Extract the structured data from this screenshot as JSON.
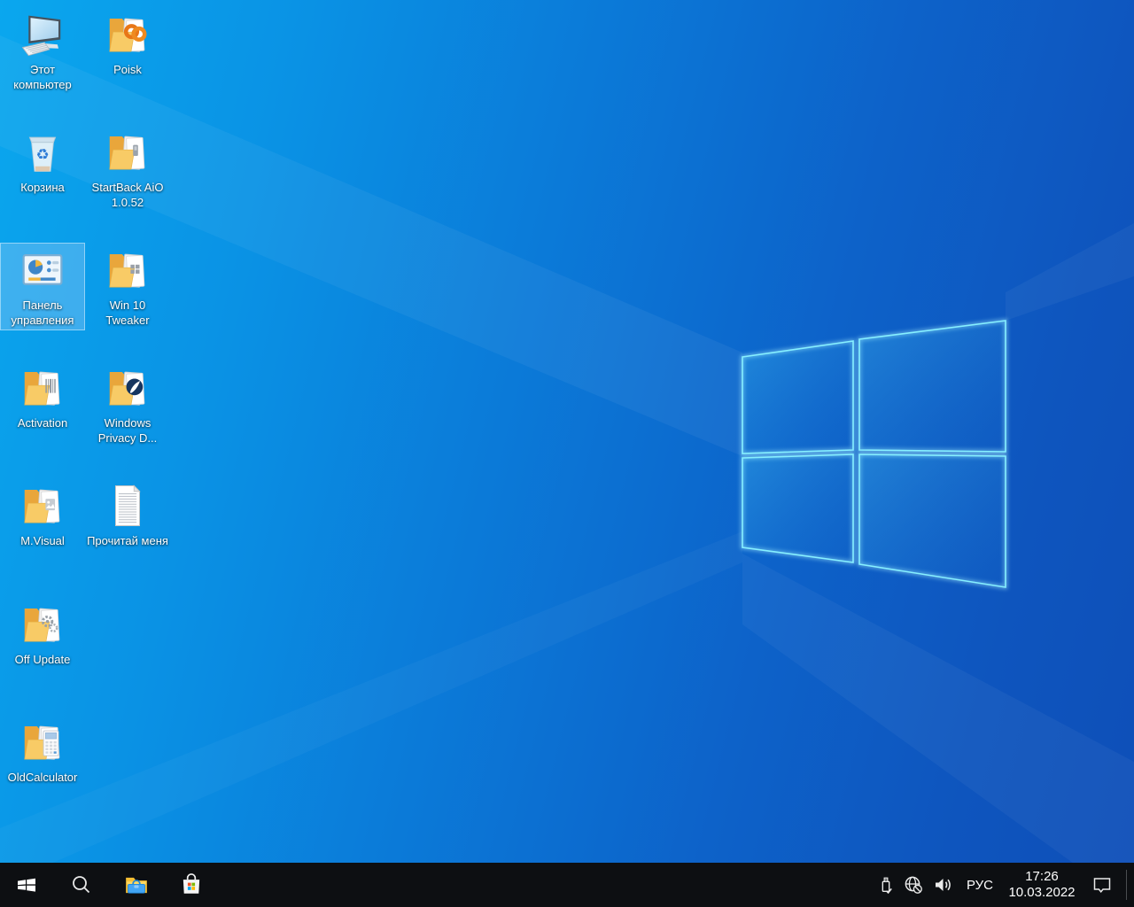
{
  "desktop": {
    "icons": [
      {
        "label": "Этот компьютер",
        "icon": "computer-icon",
        "selected": false
      },
      {
        "label": "Poisk",
        "icon": "folder-rings-icon",
        "selected": false
      },
      {
        "label": "Корзина",
        "icon": "recycle-bin-icon",
        "selected": false
      },
      {
        "label": "StartBack AiO 1.0.52",
        "icon": "folder-document-icon",
        "selected": false
      },
      {
        "label": "Панель управления",
        "icon": "control-panel-icon",
        "selected": true
      },
      {
        "label": "Win 10 Tweaker",
        "icon": "folder-windows-icon",
        "selected": false
      },
      {
        "label": "Activation",
        "icon": "folder-barcode-icon",
        "selected": false
      },
      {
        "label": "Windows Privacy D...",
        "icon": "folder-feather-icon",
        "selected": false
      },
      {
        "label": "M.Visual",
        "icon": "folder-image-icon",
        "selected": false
      },
      {
        "label": "Прочитай меня",
        "icon": "text-document-icon",
        "selected": false
      },
      {
        "label": "Off Update",
        "icon": "folder-gears-icon",
        "selected": false
      },
      {
        "label": "OldCalculator",
        "icon": "folder-calculator-icon",
        "selected": false
      }
    ]
  },
  "taskbar": {
    "buttons": [
      {
        "icon": "start-icon"
      },
      {
        "icon": "search-icon"
      },
      {
        "icon": "file-explorer-icon"
      },
      {
        "icon": "microsoft-store-icon"
      }
    ],
    "tray": {
      "icons": [
        {
          "icon": "usb-device-icon"
        },
        {
          "icon": "network-no-internet-icon"
        },
        {
          "icon": "volume-icon"
        }
      ],
      "language": "РУС",
      "clock": {
        "time": "17:26",
        "date": "10.03.2022"
      },
      "action_center_icon": "action-center-icon"
    }
  },
  "colors": {
    "wallpaper_left": "#0aa7ee",
    "wallpaper_right": "#0e4fb8",
    "taskbar_bg": "#0d0f12",
    "logo_edge_glow": "#8cf2ff",
    "selection_fill": "rgba(140,200,245,0.40)",
    "folder_yellow": "#f8cb66",
    "store_logo": [
      "#f25022",
      "#7fba00",
      "#00a4ef",
      "#ffb900"
    ]
  }
}
